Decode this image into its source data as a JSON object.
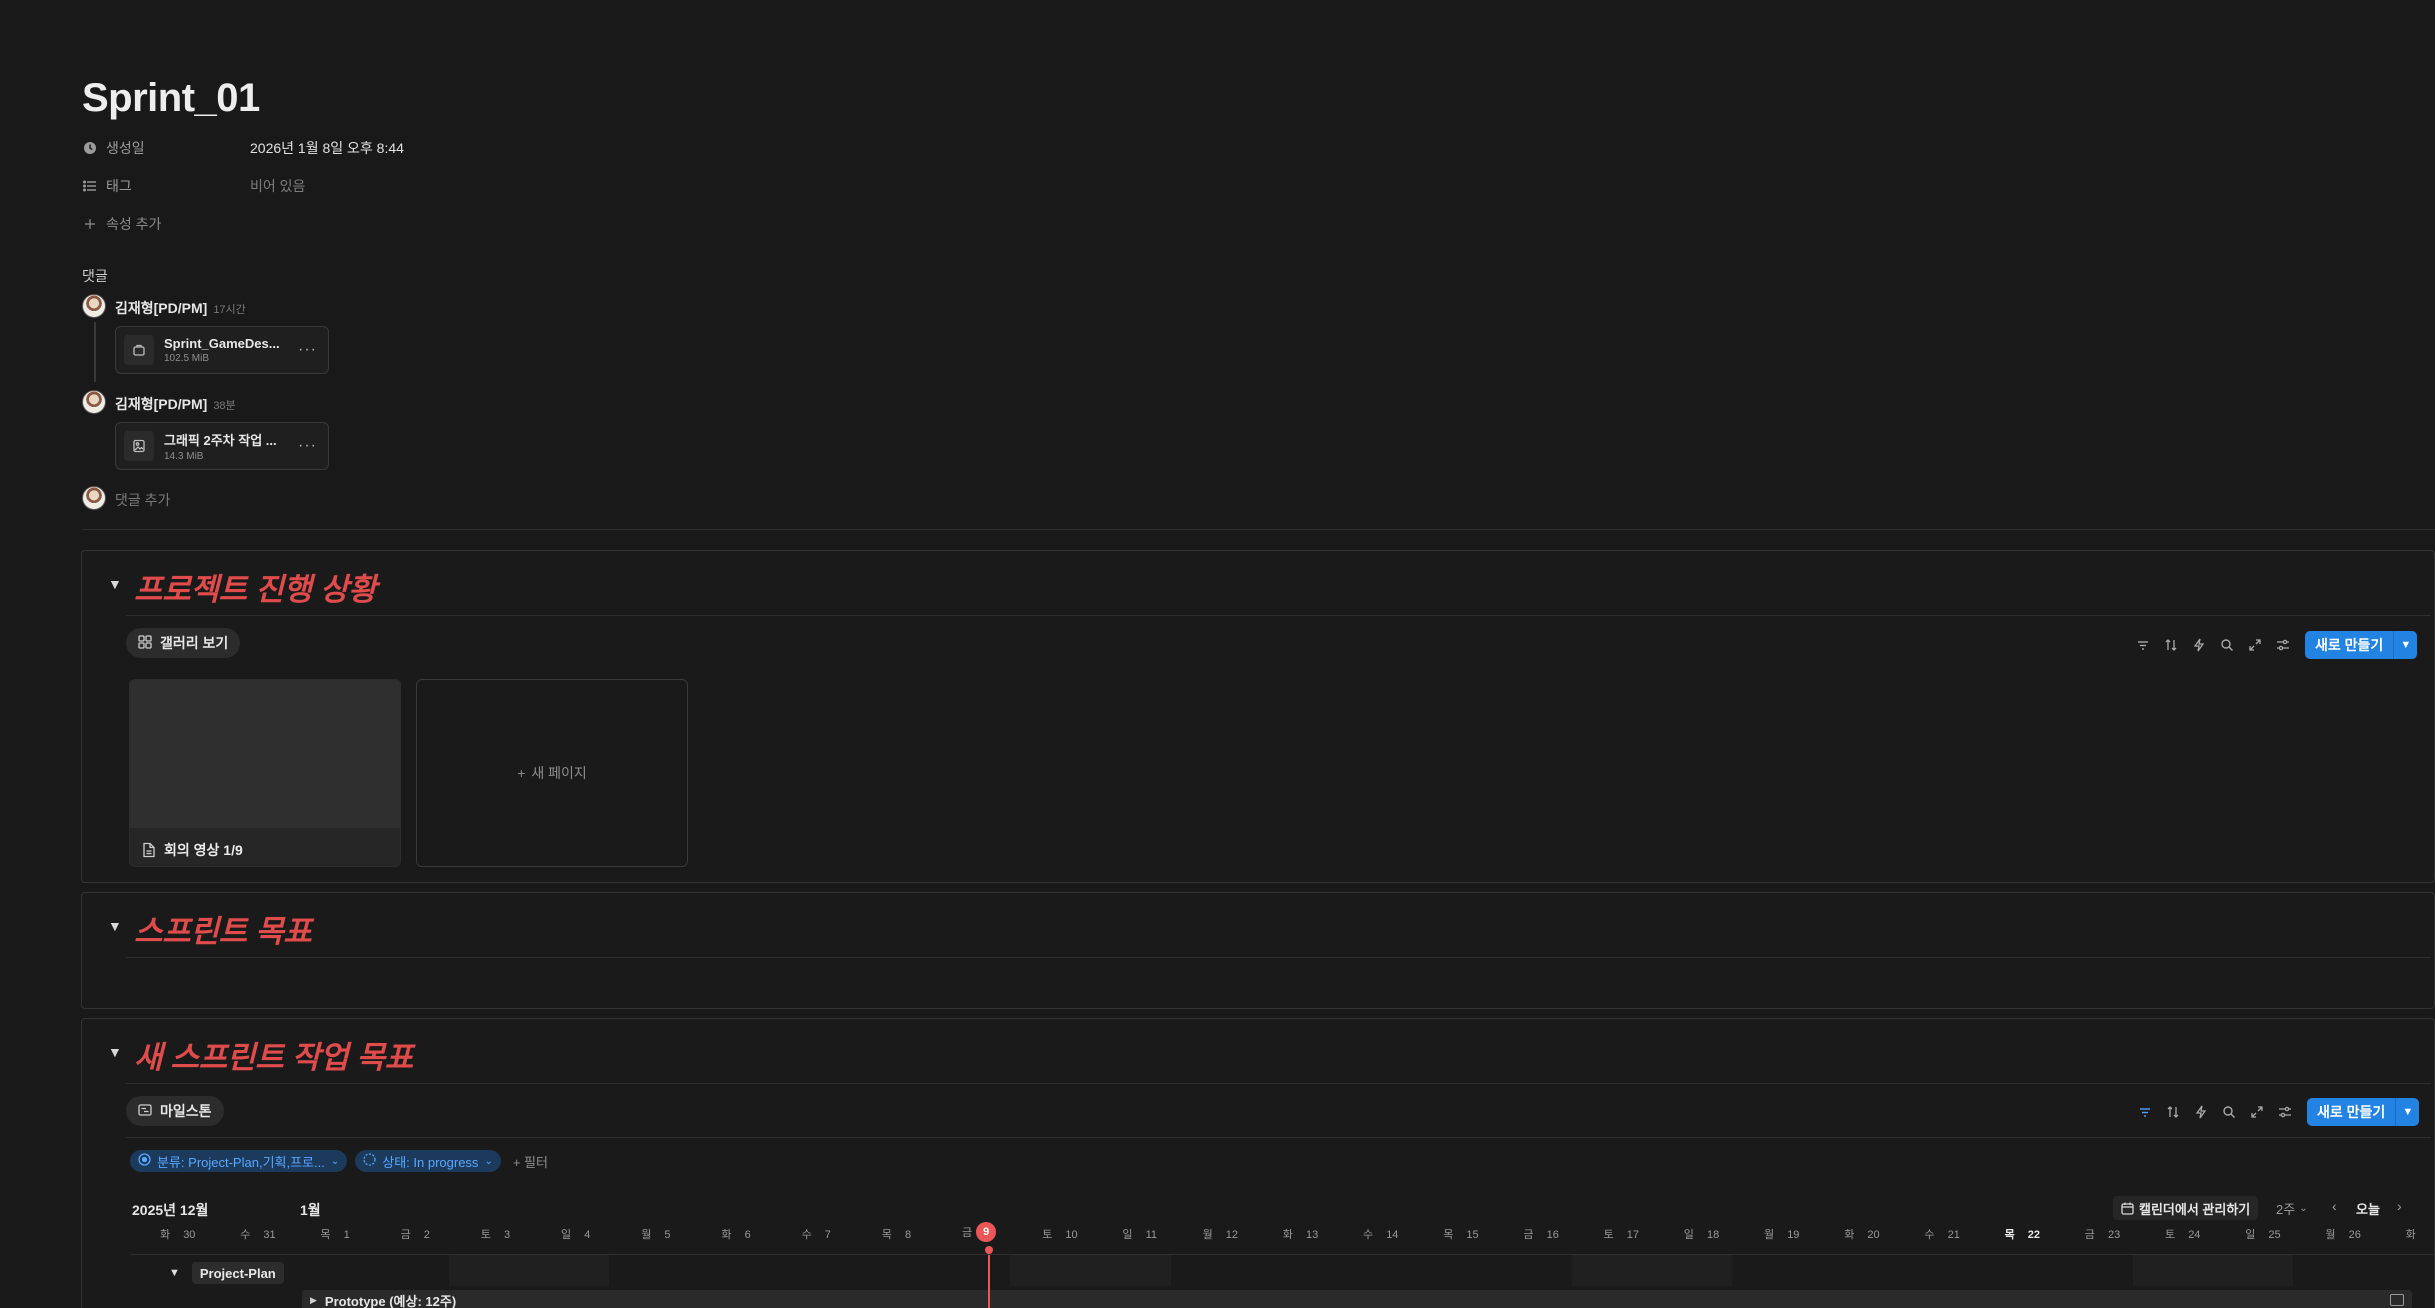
{
  "page": {
    "title": "Sprint_01"
  },
  "properties": {
    "created_label": "생성일",
    "created_value": "2026년 1월 8일 오후 8:44",
    "tags_label": "태그",
    "tags_value": "비어 있음",
    "add_property": "속성 추가"
  },
  "comments": {
    "heading": "댓글",
    "items": [
      {
        "author": "김재형[PD/PM]",
        "time": "17시간",
        "file_name": "Sprint_GameDes...",
        "file_size": "102.5 MiB"
      },
      {
        "author": "김재형[PD/PM]",
        "time": "38분",
        "file_name": "그래픽 2주차 작업 ...",
        "file_size": "14.3 MiB"
      }
    ],
    "add_placeholder": "댓글 추가"
  },
  "section1": {
    "title": "프로젝트 진행 상황",
    "view_label": "갤러리 보기",
    "new_button": "새로 만들기",
    "cards": [
      {
        "title": "회의 영상 1/9"
      }
    ],
    "new_page": "새 페이지"
  },
  "section2": {
    "title": "스프린트 목표"
  },
  "section3": {
    "title": "새 스프린트 작업 목표",
    "view_label": "마일스톤",
    "new_button": "새로 만들기",
    "filters": [
      {
        "label": "분류: Project-Plan,기획,프로..."
      },
      {
        "label": "상태: In progress"
      }
    ],
    "add_filter": "필터",
    "months": [
      "2025년 12월",
      "1월"
    ],
    "calendar_button": "캘린더에서 관리하기",
    "range": "2주",
    "today": "오늘",
    "days": [
      {
        "wd": "화",
        "d": "30"
      },
      {
        "wd": "수",
        "d": "31"
      },
      {
        "wd": "목",
        "d": "1"
      },
      {
        "wd": "금",
        "d": "2"
      },
      {
        "wd": "토",
        "d": "3"
      },
      {
        "wd": "일",
        "d": "4"
      },
      {
        "wd": "월",
        "d": "5"
      },
      {
        "wd": "화",
        "d": "6"
      },
      {
        "wd": "수",
        "d": "7"
      },
      {
        "wd": "목",
        "d": "8"
      },
      {
        "wd": "금",
        "d": "9"
      },
      {
        "wd": "토",
        "d": "10"
      },
      {
        "wd": "일",
        "d": "11"
      },
      {
        "wd": "월",
        "d": "12"
      },
      {
        "wd": "화",
        "d": "13"
      },
      {
        "wd": "수",
        "d": "14"
      },
      {
        "wd": "목",
        "d": "15"
      },
      {
        "wd": "금",
        "d": "16"
      },
      {
        "wd": "토",
        "d": "17"
      },
      {
        "wd": "일",
        "d": "18"
      },
      {
        "wd": "월",
        "d": "19"
      },
      {
        "wd": "화",
        "d": "20"
      },
      {
        "wd": "수",
        "d": "21"
      },
      {
        "wd": "목",
        "d": "22"
      },
      {
        "wd": "금",
        "d": "23"
      },
      {
        "wd": "토",
        "d": "24"
      },
      {
        "wd": "일",
        "d": "25"
      },
      {
        "wd": "월",
        "d": "26"
      },
      {
        "wd": "화",
        "d": ""
      }
    ],
    "today_index": 10,
    "bold_day_index": 23,
    "group_label": "Project-Plan",
    "row_label": "Prototype (예상: 12주)"
  },
  "colors": {
    "accent": "#2383e2",
    "section_title": "#e04b4b",
    "today": "#eb5757"
  },
  "icons": [
    "clock-icon",
    "list-icon",
    "plus-icon",
    "file-icon",
    "image-file-icon",
    "gallery-icon",
    "filter-icon",
    "sort-icon",
    "lightning-icon",
    "search-icon",
    "expand-icon",
    "settings-icon",
    "chevron-down-icon",
    "timeline-icon",
    "calendar-icon",
    "chevron-left-icon",
    "chevron-right-icon",
    "triangle-down-icon",
    "triangle-right-icon",
    "open-icon"
  ]
}
